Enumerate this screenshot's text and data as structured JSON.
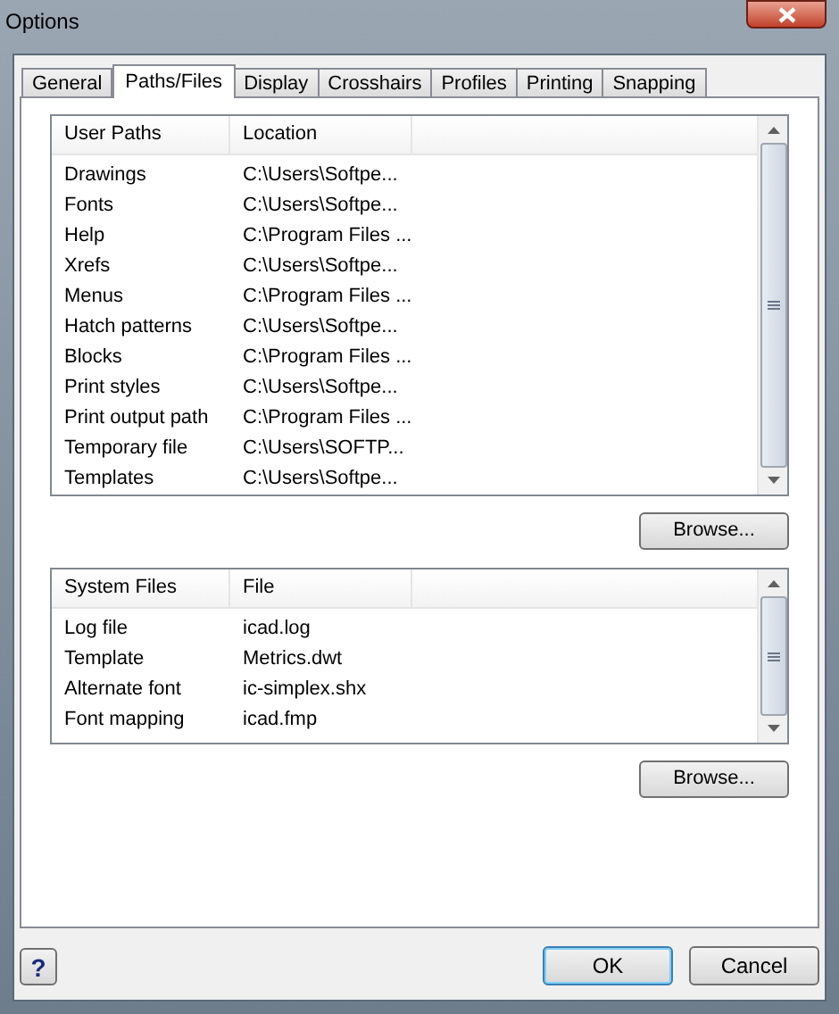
{
  "window": {
    "title": "Options"
  },
  "tabs": [
    {
      "label": "General",
      "selected": false
    },
    {
      "label": "Paths/Files",
      "selected": true
    },
    {
      "label": "Display",
      "selected": false
    },
    {
      "label": "Crosshairs",
      "selected": false
    },
    {
      "label": "Profiles",
      "selected": false
    },
    {
      "label": "Printing",
      "selected": false
    },
    {
      "label": "Snapping",
      "selected": false
    }
  ],
  "user_paths": {
    "columns": [
      "User Paths",
      "Location"
    ],
    "rows": [
      [
        "Drawings",
        "C:\\Users\\Softpe..."
      ],
      [
        "Fonts",
        "C:\\Users\\Softpe..."
      ],
      [
        "Help",
        "C:\\Program Files ..."
      ],
      [
        "Xrefs",
        "C:\\Users\\Softpe..."
      ],
      [
        "Menus",
        "C:\\Program Files ..."
      ],
      [
        "Hatch patterns",
        "C:\\Users\\Softpe..."
      ],
      [
        "Blocks",
        "C:\\Program Files ..."
      ],
      [
        "Print styles",
        "C:\\Users\\Softpe..."
      ],
      [
        "Print output path",
        "C:\\Program Files ..."
      ],
      [
        "Temporary file",
        "C:\\Users\\SOFTP..."
      ],
      [
        "Templates",
        "C:\\Users\\Softpe..."
      ]
    ],
    "button": "Browse..."
  },
  "system_files": {
    "columns": [
      "System Files",
      "File"
    ],
    "rows": [
      [
        "Log file",
        "icad.log"
      ],
      [
        "Template",
        "Metrics.dwt"
      ],
      [
        "Alternate font",
        "ic-simplex.shx"
      ],
      [
        "Font mapping",
        "icad.fmp"
      ]
    ],
    "button": "Browse..."
  },
  "footer": {
    "help": "?",
    "buttons": [
      {
        "label": "OK",
        "default": true
      },
      {
        "label": "Cancel",
        "default": false
      }
    ]
  }
}
